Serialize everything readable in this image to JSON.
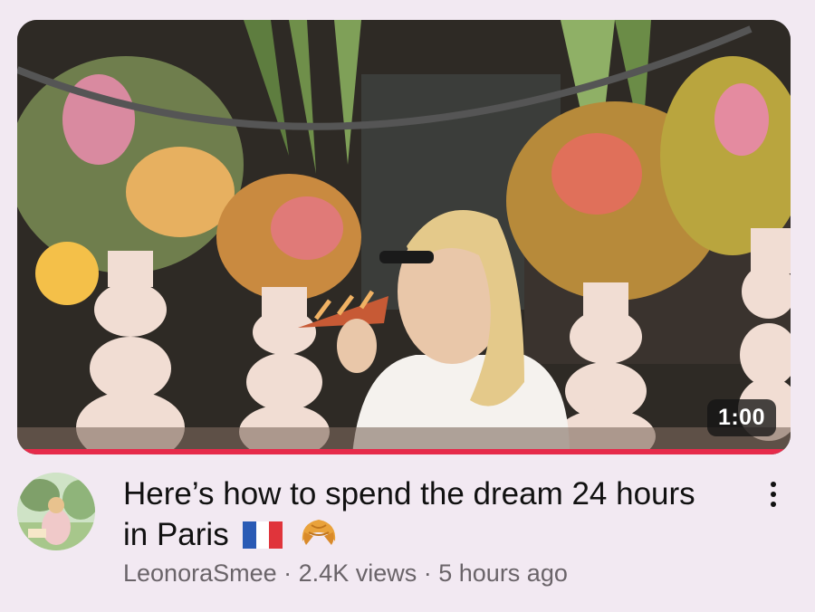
{
  "video": {
    "duration": "1:00",
    "progress_fraction": 1.0,
    "progress_color": "#e62b4b",
    "title": "Here’s how to spend the dream 24 hours in Paris",
    "title_emojis": [
      "flag-france-icon",
      "croissant-icon"
    ],
    "channel": "LeonoraSmee",
    "separator": "·",
    "views": "2.4K views",
    "posted": "5 hours ago"
  },
  "menu": {
    "icon": "more-vertical-icon"
  }
}
